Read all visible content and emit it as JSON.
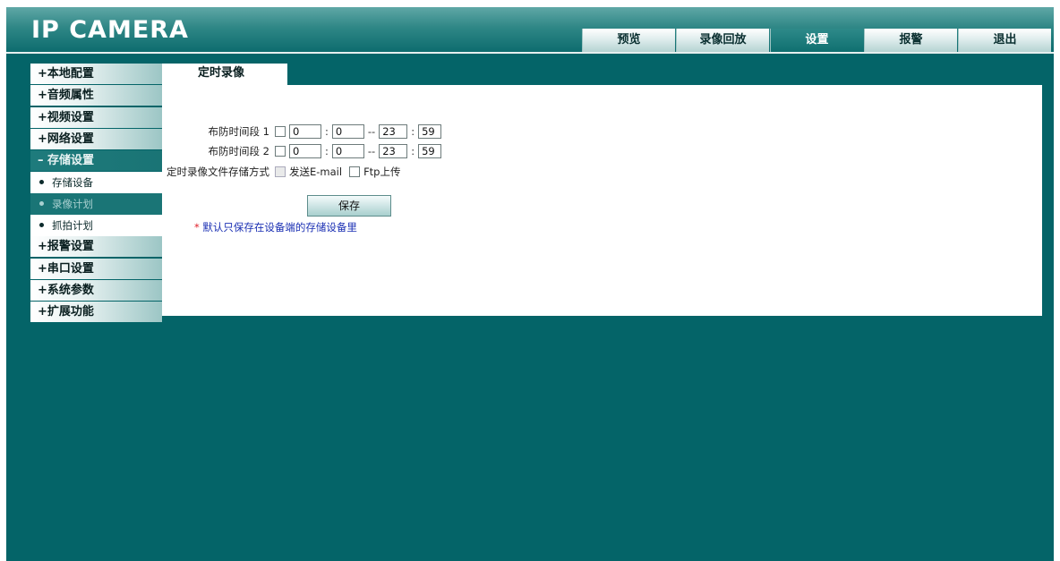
{
  "header": {
    "logo": "IP CAMERA",
    "nav": [
      "预览",
      "录像回放",
      "设置",
      "报警",
      "退出"
    ],
    "active_nav": "设置"
  },
  "sidebar": {
    "items": [
      {
        "label": "+本地配置"
      },
      {
        "label": "+音频属性"
      },
      {
        "label": "+视频设置"
      },
      {
        "label": "+网络设置"
      },
      {
        "label": "– 存储设置",
        "active": true
      },
      {
        "sub": "存储设备"
      },
      {
        "sub": "录像计划",
        "active": true
      },
      {
        "sub": "抓拍计划"
      },
      {
        "label": "+报警设置"
      },
      {
        "label": "+串口设置"
      },
      {
        "label": "+系统参数"
      },
      {
        "label": "+扩展功能"
      }
    ]
  },
  "content": {
    "tab": "定时录像",
    "period1": {
      "label": "布防时间段 1",
      "start_h": "0",
      "start_m": "0",
      "dash": "--",
      "end_h": "23",
      "end_m": "59"
    },
    "period2": {
      "label": "布防时间段 2",
      "start_h": "0",
      "start_m": "0",
      "dash": "--",
      "end_h": "23",
      "end_m": "59"
    },
    "storage": {
      "label": "定时录像文件存储方式",
      "email": "发送E-mail",
      "ftp": "Ftp上传"
    },
    "save": "保存",
    "note_star": "*",
    "note": " 默认只保存在设备端的存储设备里"
  },
  "colors": {
    "background": "#046468",
    "accent": "#1a7576",
    "note_text": "#1a2fb3",
    "note_star": "#e0202a"
  }
}
